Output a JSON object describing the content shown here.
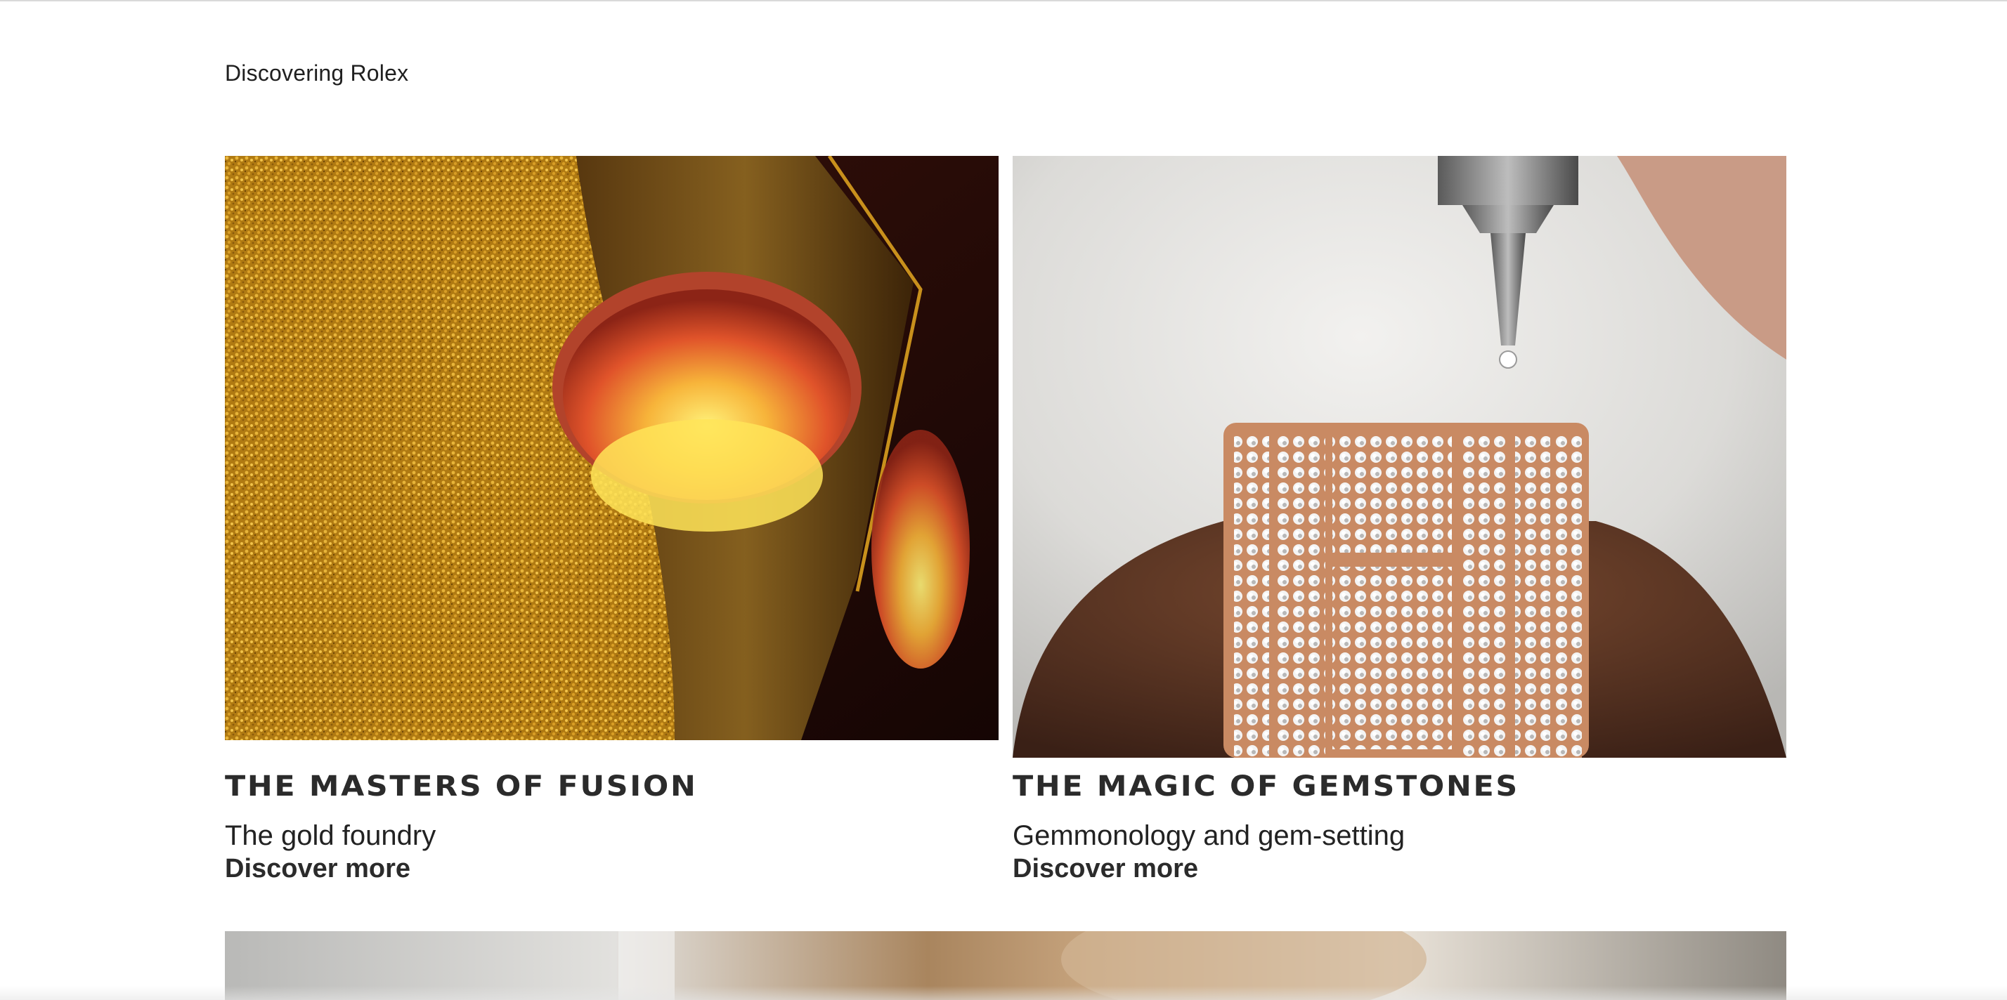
{
  "breadcrumb": "Discovering Rolex",
  "cards": [
    {
      "title": "THE MASTERS OF FUSION",
      "subtitle": "The gold foundry",
      "link_label": "Discover more",
      "image_alt": "Gold granules poured from a glowing crucible"
    },
    {
      "title": "THE MAGIC OF GEMSTONES",
      "subtitle": "Gemmonology and gem-setting",
      "link_label": "Discover more",
      "image_alt": "Diamond held by tweezers above a gem-set rose gold bracelet"
    }
  ],
  "colors": {
    "gold": "#c8901c",
    "molten": "#f5a623",
    "rose_gold": "#c98a63",
    "text": "#222222"
  }
}
